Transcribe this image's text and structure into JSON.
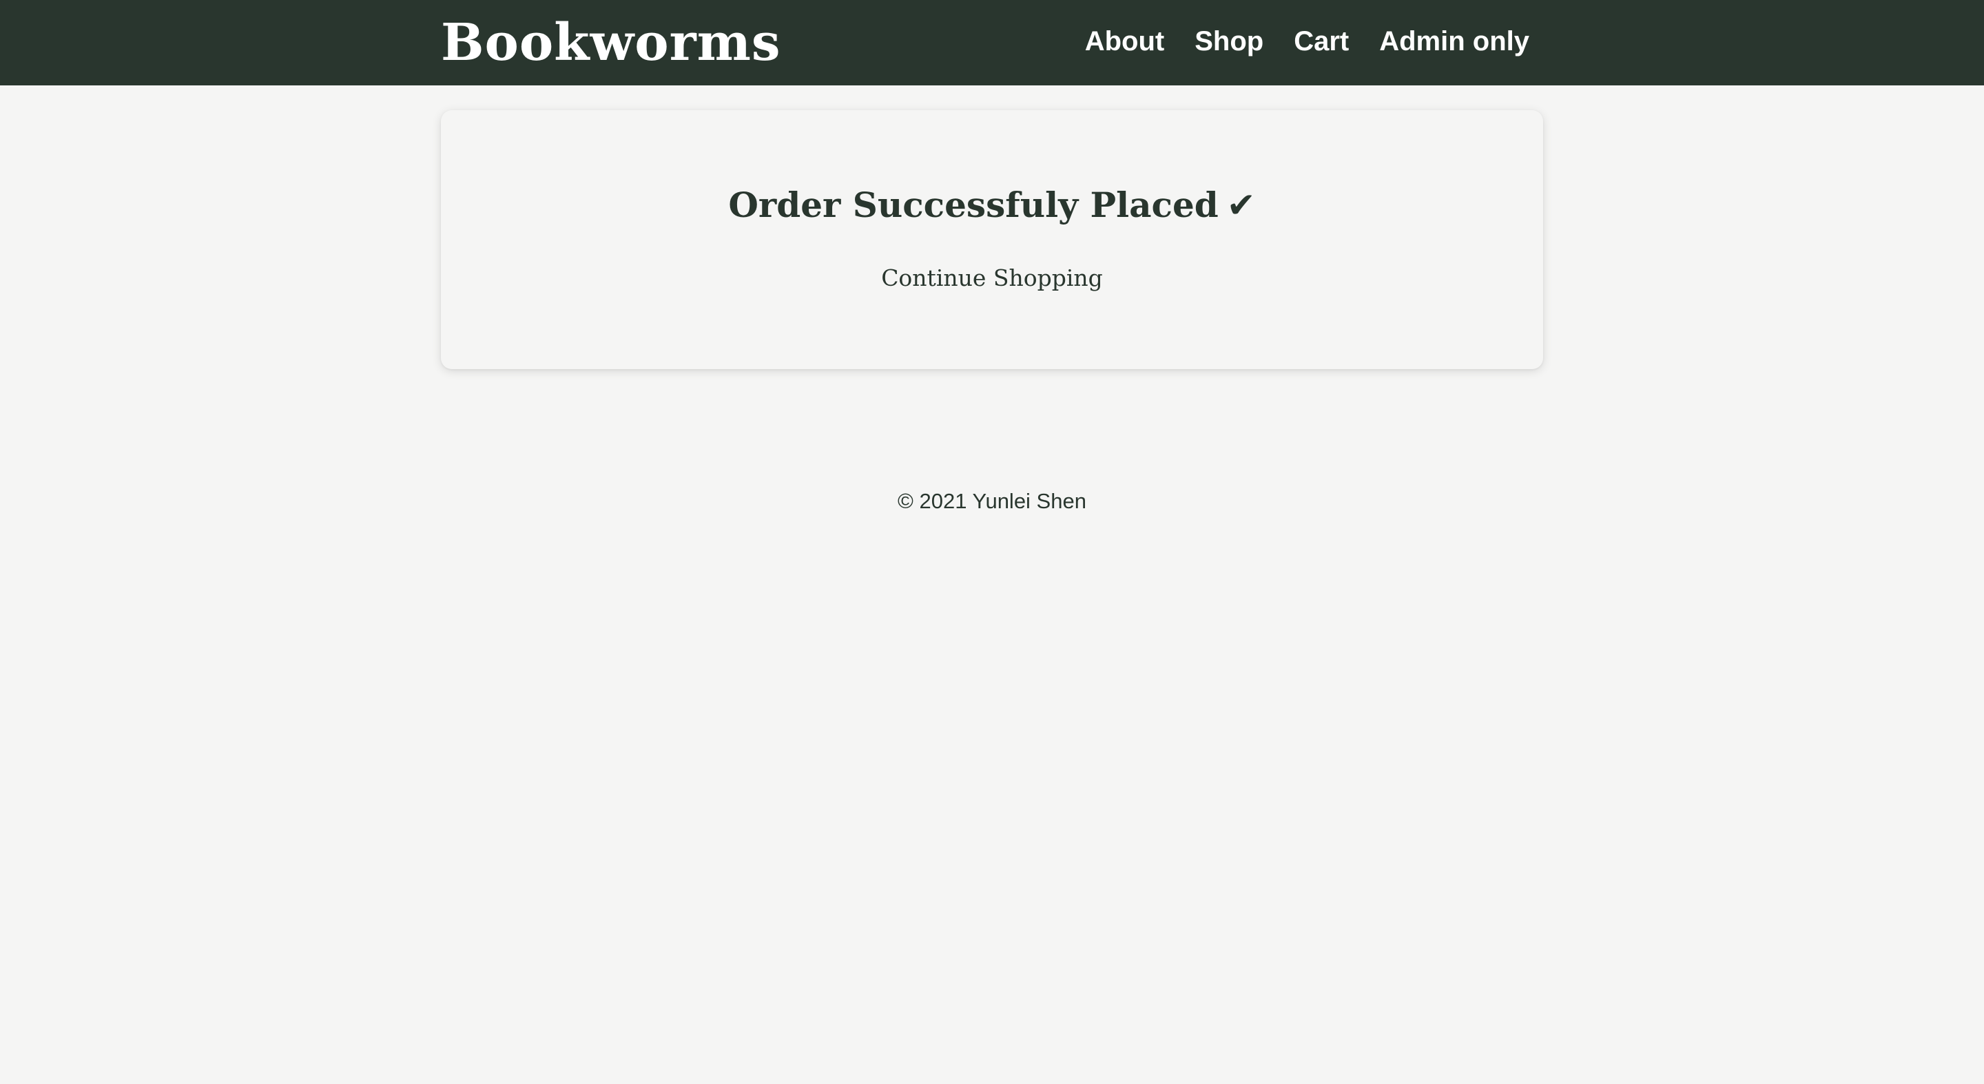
{
  "header": {
    "brand": "Bookworms",
    "nav": [
      {
        "label": "About"
      },
      {
        "label": "Shop"
      },
      {
        "label": "Cart"
      },
      {
        "label": "Admin only"
      }
    ]
  },
  "confirmation": {
    "title": "Order Successfuly Placed",
    "check_icon": "✔",
    "continue_label": "Continue Shopping"
  },
  "footer": {
    "copyright": "© 2021 Yunlei Shen"
  },
  "colors": {
    "navbar_bg": "#29362e",
    "page_bg": "#f5f5f4",
    "text_dark": "#29362e",
    "nav_text": "#ffffff"
  }
}
